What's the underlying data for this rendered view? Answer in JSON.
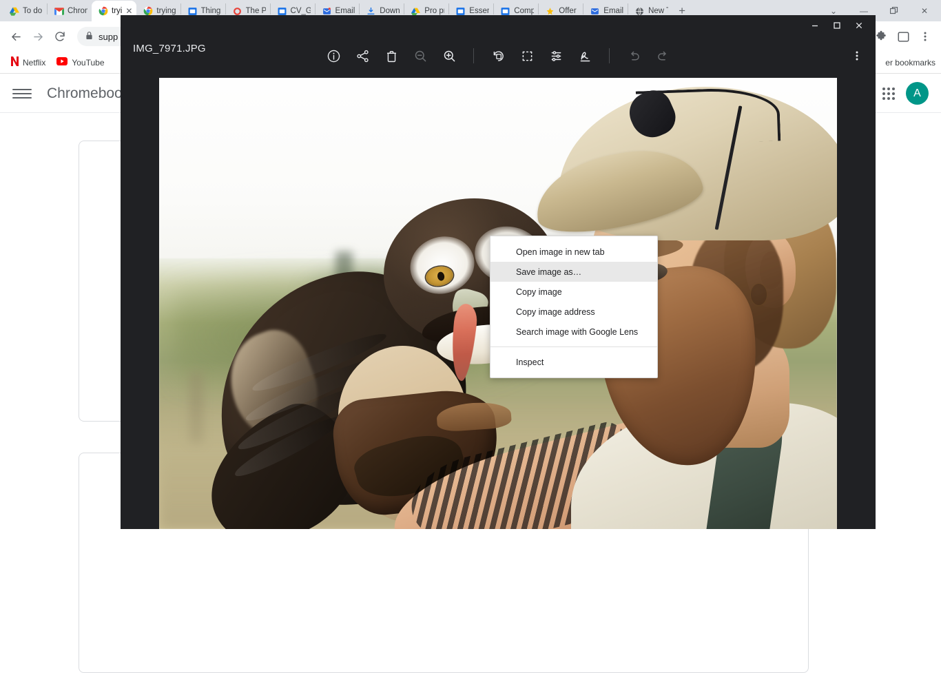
{
  "browser": {
    "tabs": [
      {
        "title": "To do l",
        "icon": "drive-icon",
        "active": false
      },
      {
        "title": "Chrom",
        "icon": "gmail-icon",
        "active": false
      },
      {
        "title": "tryi",
        "icon": "chrome-icon",
        "active": true
      },
      {
        "title": "trying",
        "icon": "chrome-icon",
        "active": false
      },
      {
        "title": "Things",
        "icon": "slides-icon",
        "active": false
      },
      {
        "title": "The Pl",
        "icon": "chrome-red-icon",
        "active": false
      },
      {
        "title": "CV_G",
        "icon": "slides-icon",
        "active": false
      },
      {
        "title": "Email",
        "icon": "mail-blue-icon",
        "active": false
      },
      {
        "title": "Downl",
        "icon": "download-icon",
        "active": false
      },
      {
        "title": "Pro pr",
        "icon": "drive-icon",
        "active": false
      },
      {
        "title": "Essent",
        "icon": "slides-icon",
        "active": false
      },
      {
        "title": "Comp",
        "icon": "slides-icon",
        "active": false
      },
      {
        "title": "Offer S",
        "icon": "star-icon",
        "active": false
      },
      {
        "title": "Email",
        "icon": "mail-blue-icon",
        "active": false
      },
      {
        "title": "New T",
        "icon": "globe-icon",
        "active": false
      }
    ],
    "new_tab_label": "+",
    "tabstrip_controls": [
      "tabsearch-icon",
      "minimize-icon",
      "restore-icon",
      "close-icon"
    ],
    "toolbar": {
      "back_icon": "back-arrow-icon",
      "forward_icon": "forward-arrow-icon",
      "reload_icon": "reload-icon",
      "lock_icon": "lock-icon",
      "url": "supp",
      "extensions_icon": "puzzle-piece-icon",
      "sidepanel_icon": "side-panel-icon",
      "menu_icon": "three-dot-menu-icon"
    },
    "bookmarks": [
      {
        "label": "Netflix",
        "icon": "netflix-icon"
      },
      {
        "label": "YouTube",
        "icon": "youtube-icon"
      }
    ],
    "other_bookmarks_label": "er bookmarks",
    "window_controls": [
      "minimize-icon",
      "restore-icon",
      "close-icon"
    ]
  },
  "page": {
    "menu_icon": "hamburger-menu-icon",
    "title": "Chromebook",
    "apps_icon": "google-apps-grid-icon",
    "avatar_initial": "A"
  },
  "viewer": {
    "filename": "IMG_7971.JPG",
    "window_controls": {
      "minimize": "minimize-icon",
      "maximize": "maximize-icon",
      "close": "close-icon"
    },
    "toolbar": [
      {
        "name": "info-icon",
        "label": "Info",
        "disabled": false
      },
      {
        "name": "share-icon",
        "label": "Share",
        "disabled": false
      },
      {
        "name": "delete-icon",
        "label": "Delete",
        "disabled": false
      },
      {
        "name": "zoom-out-icon",
        "label": "Zoom out",
        "disabled": true
      },
      {
        "name": "zoom-in-icon",
        "label": "Zoom in",
        "disabled": false
      },
      {
        "name": "separator",
        "label": "",
        "disabled": false
      },
      {
        "name": "rotate-icon",
        "label": "Rotate",
        "disabled": false
      },
      {
        "name": "crop-icon",
        "label": "Crop and rotate",
        "disabled": false
      },
      {
        "name": "adjust-icon",
        "label": "Light and color",
        "disabled": false
      },
      {
        "name": "annotate-icon",
        "label": "Annotate",
        "disabled": false
      },
      {
        "name": "separator",
        "label": "",
        "disabled": false
      },
      {
        "name": "undo-icon",
        "label": "Undo",
        "disabled": true
      },
      {
        "name": "redo-icon",
        "label": "Redo",
        "disabled": true
      }
    ],
    "more_menu_icon": "three-dot-menu-icon",
    "image_alt": "Spectacled owl perched on a falconry glove held by a bearded man in a tan cap"
  },
  "context_menu": {
    "items": [
      {
        "label": "Open image in new tab",
        "highlighted": false
      },
      {
        "label": "Save image as…",
        "highlighted": true
      },
      {
        "label": "Copy image",
        "highlighted": false
      },
      {
        "label": "Copy image address",
        "highlighted": false
      },
      {
        "label": "Search image with Google Lens",
        "highlighted": false
      }
    ],
    "footer_items": [
      {
        "label": "Inspect",
        "highlighted": false
      }
    ]
  },
  "colors": {
    "viewer_bg": "#202124",
    "tabstrip_bg": "#dee1e6",
    "avatar_bg": "#009688",
    "menu_highlight": "#e8e8e8",
    "omnibox_bg": "#f1f3f4"
  }
}
